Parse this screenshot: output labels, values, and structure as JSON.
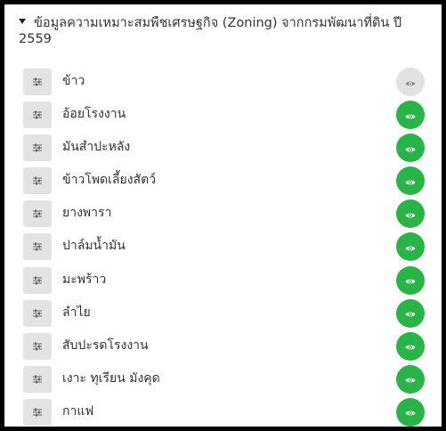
{
  "panel": {
    "title": "ข้อมูลความเหมาะสมพืชเศรษฐกิจ (Zoning) จากกรมพัฒนาที่ดิน ปี 2559",
    "colors": {
      "visible": "#28b446",
      "hidden": "#e2e2e2"
    }
  },
  "layers": [
    {
      "label": "ข้าว",
      "visible": false
    },
    {
      "label": "อ้อยโรงงาน",
      "visible": true
    },
    {
      "label": "มันสำปะหลัง",
      "visible": true
    },
    {
      "label": "ข้าวโพดเลี้ยงสัตว์",
      "visible": true
    },
    {
      "label": "ยางพารา",
      "visible": true
    },
    {
      "label": "ปาล์มน้ำมัน",
      "visible": true
    },
    {
      "label": "มะพร้าว",
      "visible": true
    },
    {
      "label": "ลำไย",
      "visible": true
    },
    {
      "label": "สับปะรดโรงงาน",
      "visible": true
    },
    {
      "label": "เงาะ ทุเรียน มังคุด",
      "visible": true
    },
    {
      "label": "กาแฟ",
      "visible": true
    }
  ]
}
